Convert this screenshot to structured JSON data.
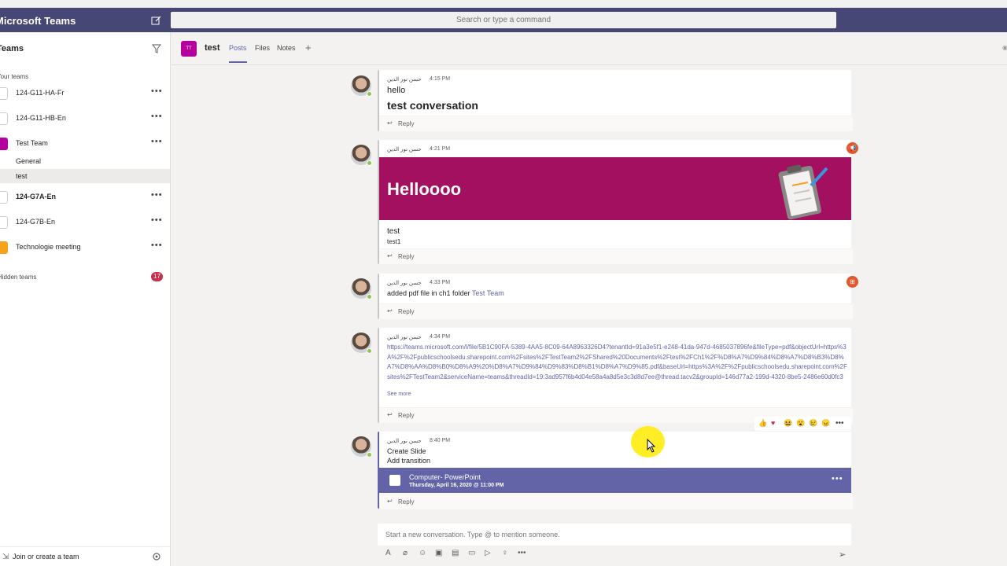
{
  "app": {
    "title": "Microsoft Teams"
  },
  "search": {
    "placeholder": "Search or type a command"
  },
  "sidebar": {
    "heading": "Teams",
    "your_teams_label": "Your teams",
    "teams": [
      {
        "name": "124-G11-HA-Fr",
        "color": "#ffffff"
      },
      {
        "name": "124-G11-HB-En",
        "color": "#ffffff"
      },
      {
        "name": "Test Team",
        "color": "#b4009e",
        "initials": "TT"
      },
      {
        "name": "124-G7A-En",
        "color": "#ffffff"
      },
      {
        "name": "124-G7B-En",
        "color": "#ffffff"
      },
      {
        "name": "Technologie meeting",
        "color": "#f7a21b"
      }
    ],
    "channels": [
      {
        "name": "General"
      },
      {
        "name": "test"
      }
    ],
    "hidden_teams_label": "Hidden teams",
    "hidden_teams_count": "17",
    "join_label": "Join or create a team"
  },
  "channel": {
    "initials": "TT",
    "name": "test",
    "tabs": [
      {
        "label": "Posts"
      },
      {
        "label": "Files"
      },
      {
        "label": "Notes"
      }
    ]
  },
  "messages": [
    {
      "author": "حسن نور الدين",
      "time": "4:15 PM",
      "line1": "hello",
      "line2": "test conversation",
      "reply": "Reply"
    },
    {
      "author": "حسن نور الدين",
      "time": "4:21 PM",
      "banner_title": "Helloooo",
      "line1": "test",
      "line2": "test1",
      "reply": "Reply"
    },
    {
      "author": "حسن نور الدين",
      "time": "4:33 PM",
      "text": "added pdf file in ch1 folder",
      "link": "Test Team",
      "reply": "Reply"
    },
    {
      "author": "حسن نور الدين",
      "time": "4:34 PM",
      "url": "https://teams.microsoft.com/l/file/5B1C90FA-5389-4AA5-8C09-64A8963326D4?tenantId=91a3e5f1-e248-41da-947d-4685037896fe&fileType=pdf&objectUrl=https%3A%2F%2Fpublicschoolsedu.sharepoint.com%2Fsites%2FTestTeam2%2FShared%20Documents%2Ftest%2FCh1%2F%D8%A7%D9%84%D8%A7%D8%B3%D8%A7%D8%AA%D8%B0%D8%A9%20%D8%A7%D9%84%D9%83%D8%B1%D8%A7%D9%85.pdf&baseUrl=https%3A%2F%2Fpublicschoolsedu.sharepoint.com%2Fsites%2FTestTeam2&serviceName=teams&threadId=19:3ad957f6b4d04e58a4a8d5e3c3d8d7ee@thread.tacv2&groupId=146d77a2-199d-4320-8be5-2486e60d0fc3",
      "see_more": "See more",
      "reply": "Reply"
    },
    {
      "author": "حسن نور الدين",
      "time": "8:40 PM",
      "line1": "Create Slide",
      "line2": "Add transition",
      "event_title": "Computer- PowerPoint",
      "event_date": "Thursday, April 16, 2020 @ 11:00 PM",
      "reply": "Reply"
    }
  ],
  "compose": {
    "placeholder": "Start a new conversation. Type @ to mention someone."
  },
  "colors": {
    "titlebar": "#464775",
    "accent": "#6264a7",
    "banner": "#a2105f",
    "presence": "#92c353",
    "badge": "#c4314b"
  }
}
